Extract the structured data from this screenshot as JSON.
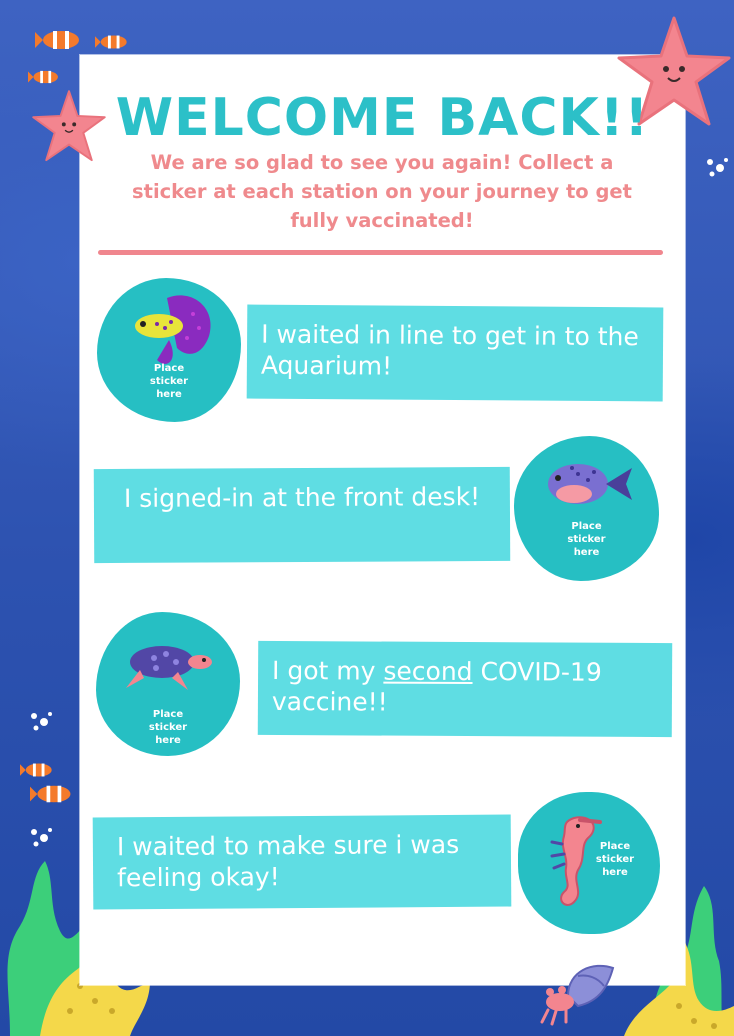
{
  "header": {
    "title": "WELCOME BACK!!",
    "subtitle": "We are so glad to see you again! Collect a sticker at each station on your journey to get fully vaccinated!"
  },
  "stations": [
    {
      "text": "I waited in line to get in to the Aquarium!",
      "sticker_label": "Place sticker here",
      "icon": "betta-fish-icon"
    },
    {
      "text": "I signed-in at the front desk!",
      "sticker_label": "Place sticker here",
      "icon": "pufferfish-icon"
    },
    {
      "text_before": "I got my ",
      "text_emphasis": "second",
      "text_after": " COVID-19 vaccine!!",
      "sticker_label": "Place sticker here",
      "icon": "sea-turtle-icon"
    },
    {
      "text": "I waited to make sure i was feeling okay!",
      "sticker_label": "Place sticker here",
      "icon": "seahorse-icon"
    }
  ],
  "colors": {
    "background": "#2f55b3",
    "title": "#2cc0c8",
    "subtitle": "#ef8a8d",
    "bar": "#5fdde3",
    "sticker": "#26bfc3",
    "starfish": "#f3858f",
    "coral_green": "#3ccf7a",
    "coral_yellow": "#f4d84a"
  }
}
